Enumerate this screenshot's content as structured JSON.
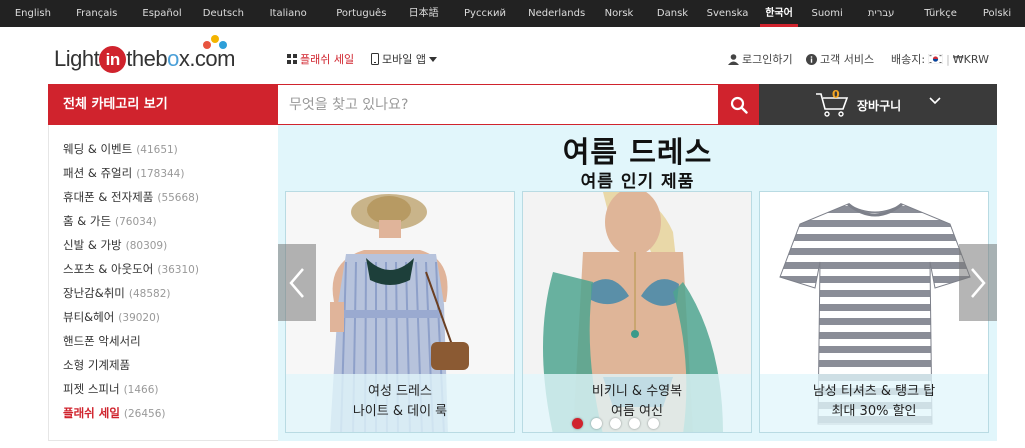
{
  "languages": [
    {
      "label": "English",
      "w": 67
    },
    {
      "label": "Français",
      "w": 63
    },
    {
      "label": "Español",
      "w": 70
    },
    {
      "label": "Deutsch",
      "w": 55
    },
    {
      "label": "Italiano",
      "w": 77
    },
    {
      "label": "Português",
      "w": 72
    },
    {
      "label": "日本語",
      "w": 55
    },
    {
      "label": "Русский",
      "w": 70
    },
    {
      "label": "Nederlands",
      "w": 76
    },
    {
      "label": "Norsk",
      "w": 51
    },
    {
      "label": "Dansk",
      "w": 58
    },
    {
      "label": "Svenska",
      "w": 54
    },
    {
      "label": "한국어",
      "w": 51,
      "active": true
    },
    {
      "label": "Suomi",
      "w": 47
    },
    {
      "label": "עברית",
      "w": 63
    },
    {
      "label": "Türkçe",
      "w": 58
    },
    {
      "label": "Polski",
      "w": 57
    }
  ],
  "header": {
    "logo": {
      "light": "Light",
      "in": "in",
      "the": "the",
      "bo": "b",
      "x": "x",
      "com": ".com"
    },
    "flash_sale": "플래쉬 세일",
    "mobile_app": "모바일 앱",
    "login": "로그인하기",
    "customer_service": "고객 서비스",
    "ship_to_label": "배송지:",
    "currency": "₩KRW"
  },
  "nav": {
    "all_categories": "전체 카테고리 보기",
    "search_placeholder": "무엇을 찾고 있나요?",
    "cart_count": "0",
    "cart_label": "장바구니"
  },
  "categories": [
    {
      "label": "웨딩 & 이벤트",
      "count": "(41651)"
    },
    {
      "label": "패션 & 쥬얼리",
      "count": "(178344)"
    },
    {
      "label": "휴대폰 & 전자제품",
      "count": "(55668)"
    },
    {
      "label": "홈 & 가든",
      "count": "(76034)"
    },
    {
      "label": "신발 & 가방",
      "count": "(80309)"
    },
    {
      "label": "스포츠 & 아웃도어",
      "count": "(36310)"
    },
    {
      "label": "장난감&취미",
      "count": "(48582)"
    },
    {
      "label": "뷰티&헤어",
      "count": "(39020)"
    },
    {
      "label": "핸드폰 악세서리",
      "count": ""
    },
    {
      "label": "소형 기계제품",
      "count": ""
    },
    {
      "label": "피젯 스피너",
      "count": "(1466)"
    },
    {
      "label": "플래쉬 세일",
      "count": "(26456)",
      "flash": true
    }
  ],
  "banner": {
    "title": "여름 드레스",
    "subtitle": "여름 인기 제품",
    "cards": [
      {
        "line1": "여성 드레스",
        "line2": "나이트 & 데이 룩"
      },
      {
        "line1": "비키니 & 수영복",
        "line2": "여름 여신"
      },
      {
        "line1": "남성 티셔츠 & 탱크 탑",
        "line2": "최대 30% 할인"
      }
    ],
    "dots": 5,
    "active_dot": 0
  },
  "colors": {
    "brand_red": "#d0232d",
    "langbar_bg": "#222222",
    "cart_bg": "#3a3a3a",
    "banner_bg": "#e1f6fb"
  }
}
